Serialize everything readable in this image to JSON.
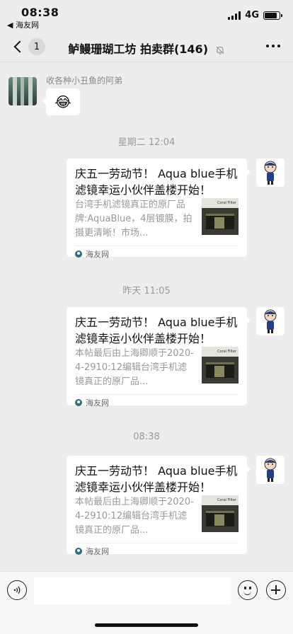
{
  "status_bar": {
    "time": "08:38",
    "back_app": "◀ 海友网",
    "network": "4G",
    "battery_level": 0.85
  },
  "nav": {
    "unread_count": "1",
    "title": "鲈鳗珊瑚工坊 拍卖群(146)",
    "icons": {
      "back": "chevron-left-icon",
      "mute": "bell-slash-icon",
      "more": "ellipsis-icon"
    }
  },
  "messages": {
    "first": {
      "sender": "收各种小丑鱼的阿弟",
      "emoji": "😂"
    },
    "timestamps": [
      "星期二 12:04",
      "昨天 11:05",
      "08:38"
    ],
    "cards": [
      {
        "title": "庆五一劳动节！ Aqua blue手机滤镜幸运小伙伴盖楼开始！",
        "body": "台湾手机滤镜真正的原厂品牌:AquaBlue，4层镀膜，拍摄更清晰！市场...",
        "thumb_label": "Coral Filter",
        "source": "海友网"
      },
      {
        "title": "庆五一劳动节！ Aqua blue手机滤镜幸运小伙伴盖楼开始！",
        "body": "本帖最后由上海卿顺于2020-4-2910:12编辑台湾手机滤镜真正的原厂品...",
        "thumb_label": "Coral Filter",
        "source": "海友网"
      },
      {
        "title": "庆五一劳动节！ Aqua blue手机滤镜幸运小伙伴盖楼开始！",
        "body": "本帖最后由上海卿顺于2020-4-2910:12编辑台湾手机滤镜真正的原厂品...",
        "thumb_label": "Coral Filter",
        "source": "海友网"
      }
    ]
  },
  "input_bar": {
    "value": "",
    "icons": {
      "voice": "voice-icon",
      "emoji": "emoji-icon",
      "plus": "plus-icon"
    }
  }
}
